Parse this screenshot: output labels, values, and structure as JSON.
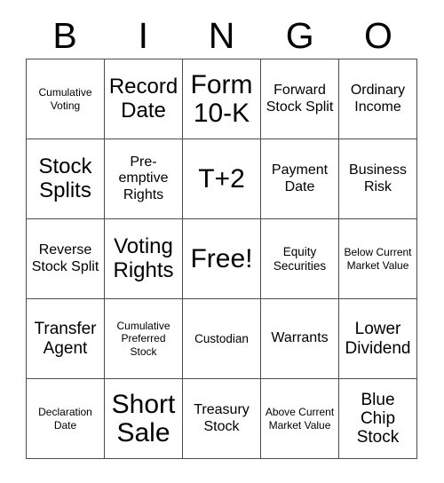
{
  "card": {
    "title_letters": [
      "B",
      "I",
      "N",
      "G",
      "O"
    ],
    "free_space_label": "Free!",
    "grid": {
      "rows": 5,
      "columns": 5,
      "cells": [
        [
          {
            "text": "Cumulative Voting",
            "size": "xs"
          },
          {
            "text": "Record Date",
            "size": "xl"
          },
          {
            "text": "Form 10-K",
            "size": "xxl"
          },
          {
            "text": "Forward Stock Split",
            "size": "m"
          },
          {
            "text": "Ordinary Income",
            "size": "m"
          }
        ],
        [
          {
            "text": "Stock Splits",
            "size": "xl"
          },
          {
            "text": "Pre-\nemptive Rights",
            "size": "m"
          },
          {
            "text": "T+2",
            "size": "xxl"
          },
          {
            "text": "Payment Date",
            "size": "m"
          },
          {
            "text": "Business Risk",
            "size": "m"
          }
        ],
        [
          {
            "text": "Reverse Stock Split",
            "size": "m"
          },
          {
            "text": "Voting Rights",
            "size": "xl"
          },
          {
            "text": "Free!",
            "size": "xxl"
          },
          {
            "text": "Equity Securities",
            "size": "s"
          },
          {
            "text": "Below Current Market Value",
            "size": "xs"
          }
        ],
        [
          {
            "text": "Transfer Agent",
            "size": "l"
          },
          {
            "text": "Cumulative Preferred Stock",
            "size": "xs"
          },
          {
            "text": "Custodian",
            "size": "s"
          },
          {
            "text": "Warrants",
            "size": "m"
          },
          {
            "text": "Lower Dividend",
            "size": "l"
          }
        ],
        [
          {
            "text": "Declaration Date",
            "size": "xs"
          },
          {
            "text": "Short Sale",
            "size": "xxl"
          },
          {
            "text": "Treasury Stock",
            "size": "m"
          },
          {
            "text": "Above Current Market Value",
            "size": "xs"
          },
          {
            "text": "Blue Chip Stock",
            "size": "l"
          }
        ]
      ]
    },
    "colors": {
      "background": "#ffffff",
      "text": "#000000",
      "grid_line": "#4d4d4d"
    }
  }
}
